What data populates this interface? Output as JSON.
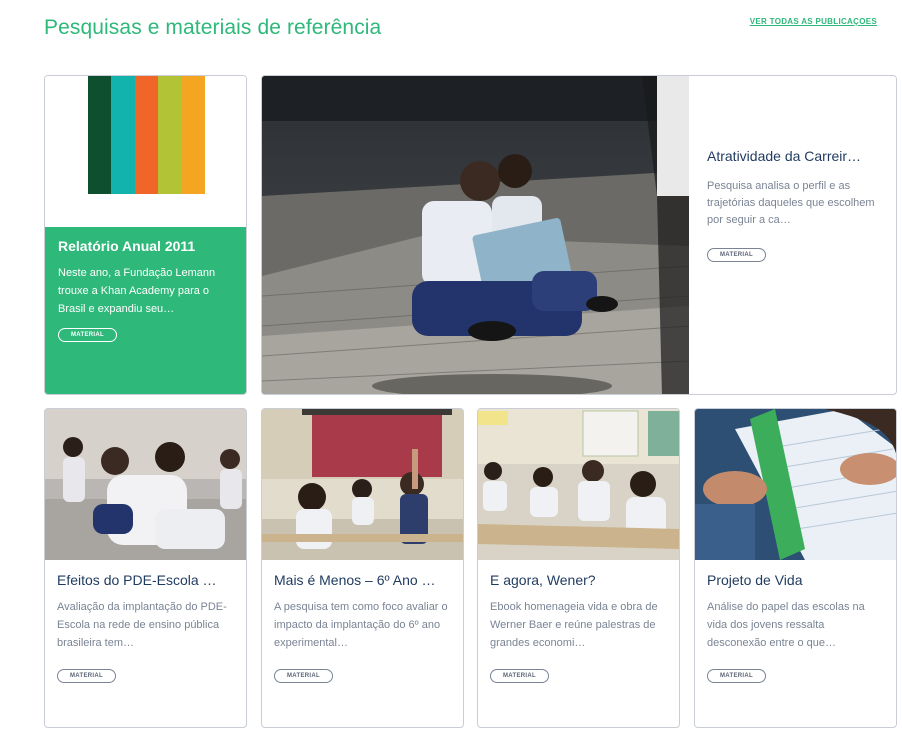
{
  "header": {
    "title": "Pesquisas e materiais de referência",
    "view_all": "VER TODAS AS PUBLICAÇOES"
  },
  "colors": {
    "accent": "#2eb87a",
    "stripes": [
      "#0d4f2e",
      "#12b3ac",
      "#f26528",
      "#b2c436",
      "#f4a623"
    ]
  },
  "featured": [
    {
      "title": "Relatório Anual 2011",
      "description": " Neste ano, a Fundação Lemann trouxe a Khan Academy para o Brasil e expandiu seu…",
      "tag": "MATERIAL"
    },
    {
      "title": "Atratividade da Carreir…",
      "description": "Pesquisa analisa o perfil e as trajetórias daqueles que escolhem por seguir a ca…",
      "tag": "MATERIAL"
    }
  ],
  "cards": [
    {
      "title": "Efeitos do PDE-Escola …",
      "description": "Avaliação da implantação do PDE-Escola na rede de ensino pública brasileira tem…",
      "tag": "MATERIAL"
    },
    {
      "title": "Mais é Menos – 6º Ano …",
      "description": "A pesquisa tem como foco avaliar o impacto da implantação do 6º ano experimental…",
      "tag": "MATERIAL"
    },
    {
      "title": "E agora, Wener?",
      "description": "Ebook homenageia vida e obra de Werner Baer e reúne palestras de grandes economi…",
      "tag": "MATERIAL"
    },
    {
      "title": "Projeto de Vida",
      "description": "Análise do papel das escolas na vida dos jovens ressalta desconexão entre o que…",
      "tag": "MATERIAL"
    }
  ]
}
